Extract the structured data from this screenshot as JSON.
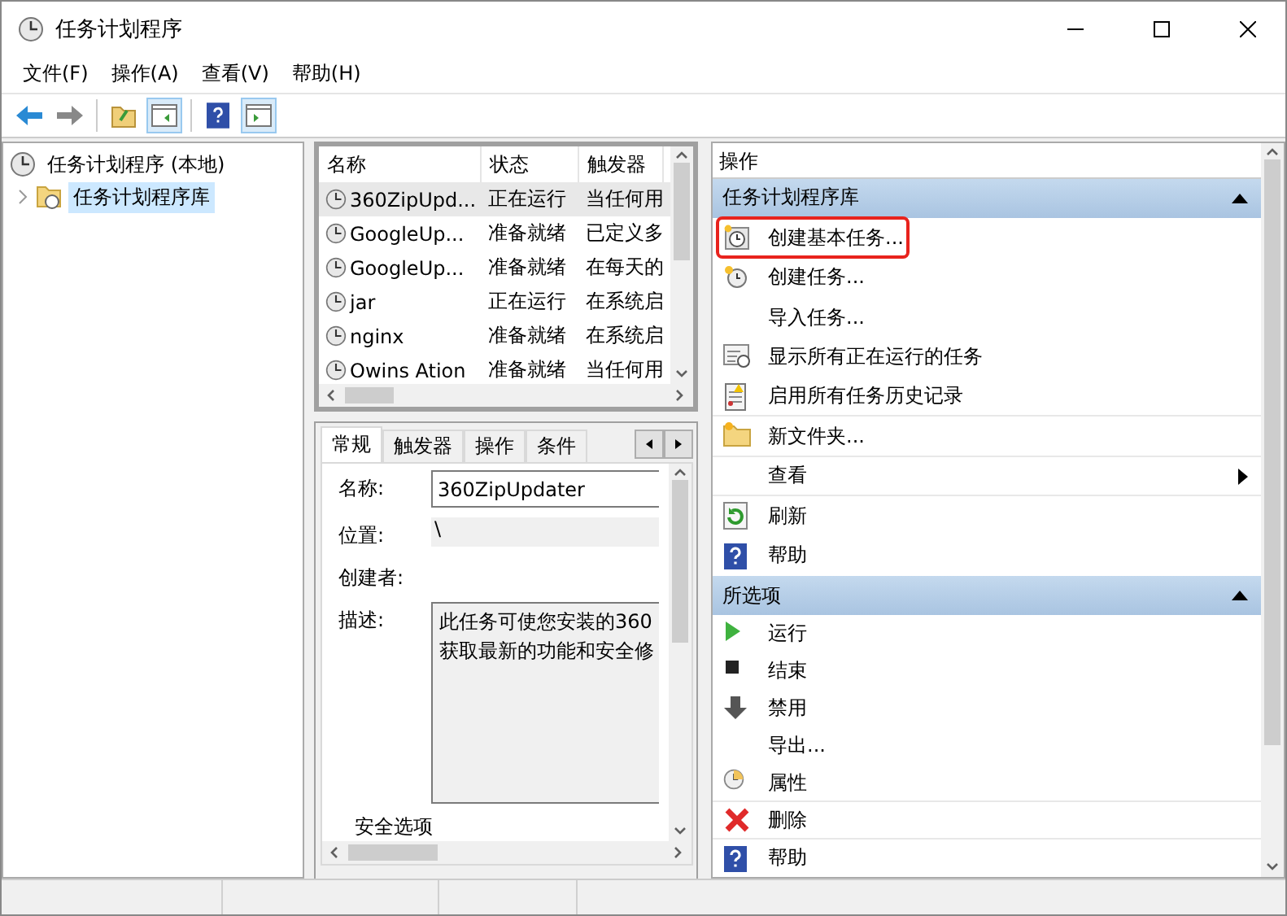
{
  "window": {
    "title": "任务计划程序"
  },
  "menu": [
    {
      "label": "文件(F)"
    },
    {
      "label": "操作(A)"
    },
    {
      "label": "查看(V)"
    },
    {
      "label": "帮助(H)"
    }
  ],
  "tree": {
    "label": "任务计划程序 (本地)",
    "children": [
      {
        "label": "任务计划程序库",
        "selected": true,
        "expanded": false
      }
    ]
  },
  "task_list": {
    "columns": [
      "名称",
      "状态",
      "触发器"
    ],
    "rows": [
      {
        "name": "360ZipUpd...",
        "status": "正在运行",
        "trigger": "当任何用",
        "selected": true
      },
      {
        "name": "GoogleUp...",
        "status": "准备就绪",
        "trigger": "已定义多",
        "selected": false
      },
      {
        "name": "GoogleUp...",
        "status": "准备就绪",
        "trigger": "在每天的",
        "selected": false
      },
      {
        "name": "jar",
        "status": "正在运行",
        "trigger": "在系统启",
        "selected": false
      },
      {
        "name": "nginx",
        "status": "准备就绪",
        "trigger": "在系统启",
        "selected": false
      },
      {
        "name": "Owins Ation",
        "status": "准备就绪",
        "trigger": "当任何用",
        "selected": false
      }
    ]
  },
  "detail": {
    "tabs": [
      {
        "label": "常规",
        "selected": true
      },
      {
        "label": "触发器",
        "selected": false
      },
      {
        "label": "操作",
        "selected": false
      },
      {
        "label": "条件",
        "selected": false
      }
    ],
    "name_label": "名称:",
    "name_value": "360ZipUpdater",
    "location_label": "位置:",
    "location_value": "\\",
    "author_label": "创建者:",
    "description_label": "描述:",
    "description_lines": [
      "此任务可使您安装的360",
      "获取最新的功能和安全修"
    ],
    "security_label": "安全选项"
  },
  "actions": {
    "header": "操作",
    "sections": [
      {
        "title": "任务计划程序库",
        "expanded": true,
        "items": [
          {
            "label": "创建基本任务...",
            "highlighted": true,
            "submenu": false
          },
          {
            "label": "创建任务...",
            "highlighted": false,
            "submenu": false
          },
          {
            "label": "导入任务...",
            "highlighted": false,
            "submenu": false
          },
          {
            "label": "显示所有正在运行的任务",
            "highlighted": false,
            "submenu": false
          },
          {
            "label": "启用所有任务历史记录",
            "highlighted": false,
            "submenu": false
          },
          {
            "label": "新文件夹...",
            "highlighted": false,
            "submenu": false
          },
          {
            "label": "查看",
            "highlighted": false,
            "submenu": true
          },
          {
            "label": "刷新",
            "highlighted": false,
            "submenu": false
          },
          {
            "label": "帮助",
            "highlighted": false,
            "submenu": false
          }
        ]
      },
      {
        "title": "所选项",
        "expanded": true,
        "items": [
          {
            "label": "运行",
            "highlighted": false,
            "submenu": false
          },
          {
            "label": "结束",
            "highlighted": false,
            "submenu": false
          },
          {
            "label": "禁用",
            "highlighted": false,
            "submenu": false
          },
          {
            "label": "导出...",
            "highlighted": false,
            "submenu": false
          },
          {
            "label": "属性",
            "highlighted": false,
            "submenu": false
          },
          {
            "label": "删除",
            "highlighted": false,
            "submenu": false
          },
          {
            "label": "帮助",
            "highlighted": false,
            "submenu": false
          }
        ]
      }
    ]
  }
}
